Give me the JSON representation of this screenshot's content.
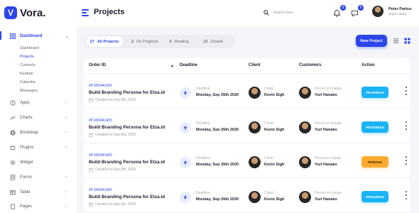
{
  "app": {
    "logo_letter": "V",
    "logo_text": "Vora.",
    "page_title": "Projects",
    "accent": "#2c46e8"
  },
  "search": {
    "placeholder": "Search here..."
  },
  "notifications": {
    "bell_count": "6",
    "chat_count": "9"
  },
  "user": {
    "name": "Peter Parkur",
    "role": "Super Admin"
  },
  "sidebar": {
    "dashboard": {
      "label": "Dashboard",
      "icon": "grid-icon"
    },
    "sub_items": [
      "Dashboard",
      "Projects",
      "Contacts",
      "Kanban",
      "Calendar",
      "Messages"
    ],
    "items": [
      {
        "label": "Apps",
        "icon": "info-icon"
      },
      {
        "label": "Charts",
        "icon": "chart-icon"
      },
      {
        "label": "Bootstrap",
        "icon": "globe-icon"
      },
      {
        "label": "Plugins",
        "icon": "puzzle-icon"
      },
      {
        "label": "Widget",
        "icon": "settings-icon"
      },
      {
        "label": "Forms",
        "icon": "form-icon"
      },
      {
        "label": "Table",
        "icon": "table-icon"
      },
      {
        "label": "Pages",
        "icon": "pages-icon"
      }
    ]
  },
  "tabs": [
    {
      "count": "27",
      "label": "All Projects"
    },
    {
      "count": "2",
      "label": "On Progress"
    },
    {
      "count": "4",
      "label": "Pending"
    },
    {
      "count": "12",
      "label": "Closed"
    }
  ],
  "new_project_label": "New Project",
  "table": {
    "headers": {
      "order": "Order ID",
      "deadline": "Deadline",
      "client": "Client",
      "customers": "Customers",
      "action": "Action"
    },
    "rows": [
      {
        "id": "#P-000441425",
        "name": "Build Branding Persona for Etza.id",
        "created": "Created on Sep 8th, 2020",
        "deadline_label": "Deadline",
        "deadline": "Monday, Sep 26th 2020",
        "client_label": "Client",
        "client": "Kevin Sigh",
        "person_label": "Person in charge",
        "person": "Yuri Hanako",
        "status": "PROGRESS"
      },
      {
        "id": "#P-000441425",
        "name": "Build Branding Persona for Etza.id",
        "created": "Created on Sep 8th, 2020",
        "deadline_label": "Deadline",
        "deadline": "Monday, Sep 26th 2020",
        "client_label": "Client",
        "client": "Kevin Sigh",
        "person_label": "Person in charge",
        "person": "Yuri Hanako",
        "status": "PROGRESS"
      },
      {
        "id": "#P-000441425",
        "name": "Build Branding Persona for Etza.id",
        "created": "Created on Sep 8th, 2020",
        "deadline_label": "Deadline",
        "deadline": "Monday, Sep 26th 2020",
        "client_label": "Client",
        "client": "Kevin Sigh",
        "person_label": "Person in charge",
        "person": "Yuri Hanako",
        "status": "PENDING"
      },
      {
        "id": "#P-000441425",
        "name": "Build Branding Persona for Etza.id",
        "created": "Created on Sep 8th, 2020",
        "deadline_label": "Deadline",
        "deadline": "Monday, Sep 26th 2020",
        "client_label": "Client",
        "client": "Kevin Sigh",
        "person_label": "Person in charge",
        "person": "Yuri Hanako",
        "status": "PROGRESS"
      }
    ]
  },
  "colors": {
    "progress": "#1ab3f5",
    "pending": "#ffab2d"
  }
}
